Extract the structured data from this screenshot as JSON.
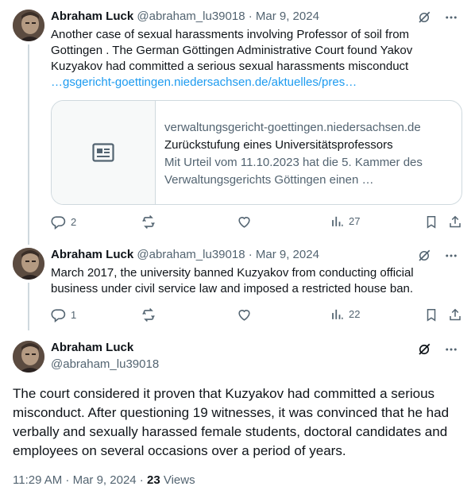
{
  "tweets": [
    {
      "author_name": "Abraham Luck",
      "author_handle": "@abraham_lu39018",
      "date": "· Mar 9, 2024",
      "text": "Another case of sexual harassments involving Professor of soil from Gottingen . The German Göttingen Administrative Court found Yakov Kuzyakov had committed a serious sexual harassments misconduct",
      "link_text": "…gsgericht-goettingen.niedersachsen.de/aktuelles/pres…",
      "card": {
        "domain": "verwaltungsgericht-goettingen.niedersachsen.de",
        "title": "Zurückstufung eines Universitätsprofessors",
        "description_line1": "Mit Urteil vom 11.10.2023 hat die 5. Kammer des",
        "description_line2": "Verwaltungsgerichts Göttingen einen …"
      },
      "replies": "2",
      "reposts": "",
      "likes": "",
      "views": "27"
    },
    {
      "author_name": "Abraham Luck",
      "author_handle": "@abraham_lu39018",
      "date": "· Mar 9, 2024",
      "text": "March 2017, the university banned Kuzyakov from conducting official business under civil service law and imposed a restricted house ban.",
      "replies": "1",
      "reposts": "",
      "likes": "",
      "views": "22"
    }
  ],
  "main_tweet": {
    "author_name": "Abraham Luck",
    "author_handle": "@abraham_lu39018",
    "text": "The court considered it proven that Kuzyakov had committed a serious misconduct. After questioning 19 witnesses, it was convinced that he had verbally and sexually harassed female students, doctoral candidates and employees on several occasions over a period of years.",
    "time": "11:29 AM · Mar 9, 2024 · ",
    "views_count": "23",
    "views_label": " Views"
  },
  "colors": {
    "text": "#0f1419",
    "secondary": "#536471",
    "link": "#1d9bf0",
    "border": "#cfd9de"
  },
  "icons": [
    "grok-icon",
    "more-icon",
    "reply-icon",
    "repost-icon",
    "like-icon",
    "views-icon",
    "bookmark-icon",
    "share-icon",
    "article-icon"
  ]
}
